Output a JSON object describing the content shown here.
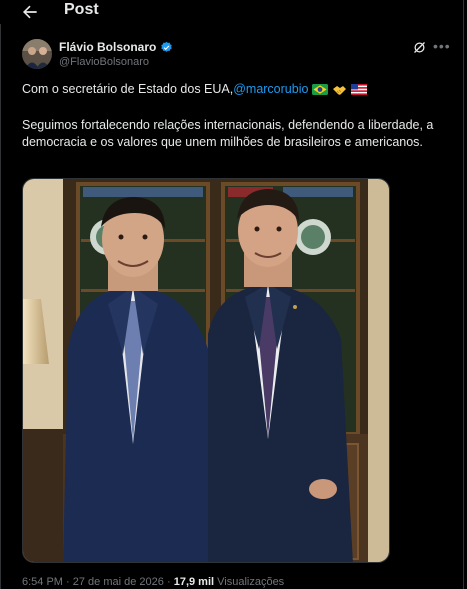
{
  "header": {
    "title": "Post"
  },
  "author": {
    "name": "Flávio Bolsonaro",
    "handle": "@FlavioBolsonaro"
  },
  "post": {
    "line1_prefix": "Com o secretário de Estado dos EUA, ",
    "mention": "@marcorubio",
    "paragraph2": "Seguimos fortalecendo relações internacionais, defendendo a liberdade, a democracia e os valores que unem milhões de brasileiros e americanos."
  },
  "meta": {
    "time": "6:54 PM",
    "date": "27 de mai de 2026",
    "views_count": "17,9 mil",
    "views_label": "Visualizações"
  },
  "colors": {
    "accent": "#1d9bf0",
    "background": "#000000",
    "muted": "#71767b"
  },
  "icons": [
    "back-arrow-icon",
    "verified-badge-icon",
    "grok-icon",
    "more-icon",
    "brazil-flag-icon",
    "handshake-icon",
    "usa-flag-icon"
  ]
}
